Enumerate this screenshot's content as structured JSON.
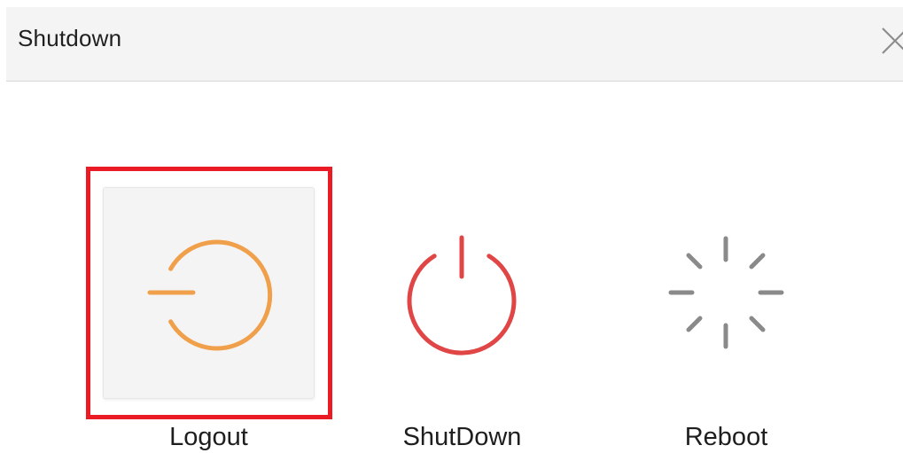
{
  "dialog": {
    "title": "Shutdown"
  },
  "actions": [
    {
      "label": "Logout",
      "icon": "logout-icon",
      "color": "#f0a04b",
      "selected": true
    },
    {
      "label": "ShutDown",
      "icon": "power-icon",
      "color": "#e04646",
      "selected": false
    },
    {
      "label": "Reboot",
      "icon": "reboot-spinner-icon",
      "color": "#8a8a8a",
      "selected": false
    }
  ],
  "colors": {
    "highlight": "#ea1b24",
    "header_bg": "#f4f4f4",
    "tile_selected_bg": "#f4f4f5"
  }
}
